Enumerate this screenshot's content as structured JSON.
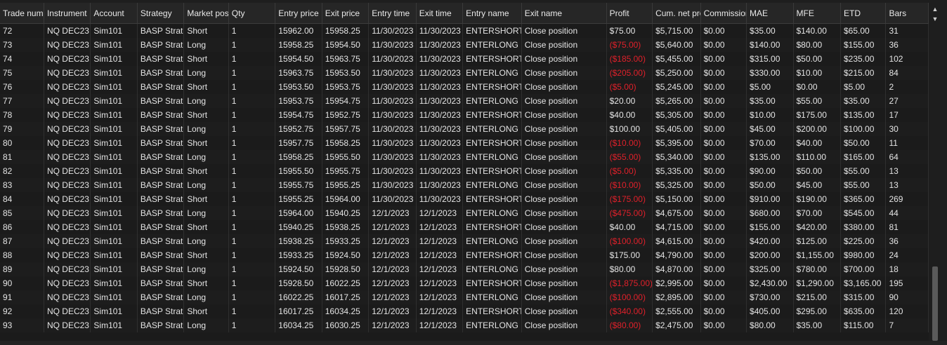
{
  "columns": [
    "Trade number",
    "Instrument",
    "Account",
    "Strategy",
    "Market position",
    "Qty",
    "Entry price",
    "Exit price",
    "Entry time",
    "Exit time",
    "Entry name",
    "Exit name",
    "Profit",
    "Cum. net profit",
    "Commission",
    "MAE",
    "MFE",
    "ETD",
    "Bars"
  ],
  "rows": [
    [
      "72",
      "NQ DEC23",
      "Sim101",
      "BASP Strat",
      "Short",
      "1",
      "15962.00",
      "15958.25",
      "11/30/2023",
      "11/30/2023",
      "ENTERSHORT",
      "Close position",
      "$75.00",
      "$5,715.00",
      "$0.00",
      "$35.00",
      "$140.00",
      "$65.00",
      "31"
    ],
    [
      "73",
      "NQ DEC23",
      "Sim101",
      "BASP Strat",
      "Long",
      "1",
      "15958.25",
      "15954.50",
      "11/30/2023",
      "11/30/2023",
      "ENTERLONG",
      "Close position",
      "($75.00)",
      "$5,640.00",
      "$0.00",
      "$140.00",
      "$80.00",
      "$155.00",
      "36"
    ],
    [
      "74",
      "NQ DEC23",
      "Sim101",
      "BASP Strat",
      "Short",
      "1",
      "15954.50",
      "15963.75",
      "11/30/2023",
      "11/30/2023",
      "ENTERSHORT",
      "Close position",
      "($185.00)",
      "$5,455.00",
      "$0.00",
      "$315.00",
      "$50.00",
      "$235.00",
      "102"
    ],
    [
      "75",
      "NQ DEC23",
      "Sim101",
      "BASP Strat",
      "Long",
      "1",
      "15963.75",
      "15953.50",
      "11/30/2023",
      "11/30/2023",
      "ENTERLONG",
      "Close position",
      "($205.00)",
      "$5,250.00",
      "$0.00",
      "$330.00",
      "$10.00",
      "$215.00",
      "84"
    ],
    [
      "76",
      "NQ DEC23",
      "Sim101",
      "BASP Strat",
      "Short",
      "1",
      "15953.50",
      "15953.75",
      "11/30/2023",
      "11/30/2023",
      "ENTERSHORT",
      "Close position",
      "($5.00)",
      "$5,245.00",
      "$0.00",
      "$5.00",
      "$0.00",
      "$5.00",
      "2"
    ],
    [
      "77",
      "NQ DEC23",
      "Sim101",
      "BASP Strat",
      "Long",
      "1",
      "15953.75",
      "15954.75",
      "11/30/2023",
      "11/30/2023",
      "ENTERLONG",
      "Close position",
      "$20.00",
      "$5,265.00",
      "$0.00",
      "$35.00",
      "$55.00",
      "$35.00",
      "27"
    ],
    [
      "78",
      "NQ DEC23",
      "Sim101",
      "BASP Strat",
      "Short",
      "1",
      "15954.75",
      "15952.75",
      "11/30/2023",
      "11/30/2023",
      "ENTERSHORT",
      "Close position",
      "$40.00",
      "$5,305.00",
      "$0.00",
      "$10.00",
      "$175.00",
      "$135.00",
      "17"
    ],
    [
      "79",
      "NQ DEC23",
      "Sim101",
      "BASP Strat",
      "Long",
      "1",
      "15952.75",
      "15957.75",
      "11/30/2023",
      "11/30/2023",
      "ENTERLONG",
      "Close position",
      "$100.00",
      "$5,405.00",
      "$0.00",
      "$45.00",
      "$200.00",
      "$100.00",
      "30"
    ],
    [
      "80",
      "NQ DEC23",
      "Sim101",
      "BASP Strat",
      "Short",
      "1",
      "15957.75",
      "15958.25",
      "11/30/2023",
      "11/30/2023",
      "ENTERSHORT",
      "Close position",
      "($10.00)",
      "$5,395.00",
      "$0.00",
      "$70.00",
      "$40.00",
      "$50.00",
      "11"
    ],
    [
      "81",
      "NQ DEC23",
      "Sim101",
      "BASP Strat",
      "Long",
      "1",
      "15958.25",
      "15955.50",
      "11/30/2023",
      "11/30/2023",
      "ENTERLONG",
      "Close position",
      "($55.00)",
      "$5,340.00",
      "$0.00",
      "$135.00",
      "$110.00",
      "$165.00",
      "64"
    ],
    [
      "82",
      "NQ DEC23",
      "Sim101",
      "BASP Strat",
      "Short",
      "1",
      "15955.50",
      "15955.75",
      "11/30/2023",
      "11/30/2023",
      "ENTERSHORT",
      "Close position",
      "($5.00)",
      "$5,335.00",
      "$0.00",
      "$90.00",
      "$50.00",
      "$55.00",
      "13"
    ],
    [
      "83",
      "NQ DEC23",
      "Sim101",
      "BASP Strat",
      "Long",
      "1",
      "15955.75",
      "15955.25",
      "11/30/2023",
      "11/30/2023",
      "ENTERLONG",
      "Close position",
      "($10.00)",
      "$5,325.00",
      "$0.00",
      "$50.00",
      "$45.00",
      "$55.00",
      "13"
    ],
    [
      "84",
      "NQ DEC23",
      "Sim101",
      "BASP Strat",
      "Short",
      "1",
      "15955.25",
      "15964.00",
      "11/30/2023",
      "11/30/2023",
      "ENTERSHORT",
      "Close position",
      "($175.00)",
      "$5,150.00",
      "$0.00",
      "$910.00",
      "$190.00",
      "$365.00",
      "269"
    ],
    [
      "85",
      "NQ DEC23",
      "Sim101",
      "BASP Strat",
      "Long",
      "1",
      "15964.00",
      "15940.25",
      "12/1/2023",
      "12/1/2023",
      "ENTERLONG",
      "Close position",
      "($475.00)",
      "$4,675.00",
      "$0.00",
      "$680.00",
      "$70.00",
      "$545.00",
      "44"
    ],
    [
      "86",
      "NQ DEC23",
      "Sim101",
      "BASP Strat",
      "Short",
      "1",
      "15940.25",
      "15938.25",
      "12/1/2023",
      "12/1/2023",
      "ENTERSHORT",
      "Close position",
      "$40.00",
      "$4,715.00",
      "$0.00",
      "$155.00",
      "$420.00",
      "$380.00",
      "81"
    ],
    [
      "87",
      "NQ DEC23",
      "Sim101",
      "BASP Strat",
      "Long",
      "1",
      "15938.25",
      "15933.25",
      "12/1/2023",
      "12/1/2023",
      "ENTERLONG",
      "Close position",
      "($100.00)",
      "$4,615.00",
      "$0.00",
      "$420.00",
      "$125.00",
      "$225.00",
      "36"
    ],
    [
      "88",
      "NQ DEC23",
      "Sim101",
      "BASP Strat",
      "Short",
      "1",
      "15933.25",
      "15924.50",
      "12/1/2023",
      "12/1/2023",
      "ENTERSHORT",
      "Close position",
      "$175.00",
      "$4,790.00",
      "$0.00",
      "$200.00",
      "$1,155.00",
      "$980.00",
      "24"
    ],
    [
      "89",
      "NQ DEC23",
      "Sim101",
      "BASP Strat",
      "Long",
      "1",
      "15924.50",
      "15928.50",
      "12/1/2023",
      "12/1/2023",
      "ENTERLONG",
      "Close position",
      "$80.00",
      "$4,870.00",
      "$0.00",
      "$325.00",
      "$780.00",
      "$700.00",
      "18"
    ],
    [
      "90",
      "NQ DEC23",
      "Sim101",
      "BASP Strat",
      "Short",
      "1",
      "15928.50",
      "16022.25",
      "12/1/2023",
      "12/1/2023",
      "ENTERSHORT",
      "Close position",
      "($1,875.00)",
      "$2,995.00",
      "$0.00",
      "$2,430.00",
      "$1,290.00",
      "$3,165.00",
      "195"
    ],
    [
      "91",
      "NQ DEC23",
      "Sim101",
      "BASP Strat",
      "Long",
      "1",
      "16022.25",
      "16017.25",
      "12/1/2023",
      "12/1/2023",
      "ENTERLONG",
      "Close position",
      "($100.00)",
      "$2,895.00",
      "$0.00",
      "$730.00",
      "$215.00",
      "$315.00",
      "90"
    ],
    [
      "92",
      "NQ DEC23",
      "Sim101",
      "BASP Strat",
      "Short",
      "1",
      "16017.25",
      "16034.25",
      "12/1/2023",
      "12/1/2023",
      "ENTERSHORT",
      "Close position",
      "($340.00)",
      "$2,555.00",
      "$0.00",
      "$405.00",
      "$295.00",
      "$635.00",
      "120"
    ],
    [
      "93",
      "NQ DEC23",
      "Sim101",
      "BASP Strat",
      "Long",
      "1",
      "16034.25",
      "16030.25",
      "12/1/2023",
      "12/1/2023",
      "ENTERLONG",
      "Close position",
      "($80.00)",
      "$2,475.00",
      "$0.00",
      "$80.00",
      "$35.00",
      "$115.00",
      "7"
    ]
  ],
  "negative_color": "#e0202a",
  "scrollbar": {
    "up_icon": "chevron-up-icon",
    "down_icon": "chevron-down-icon"
  }
}
